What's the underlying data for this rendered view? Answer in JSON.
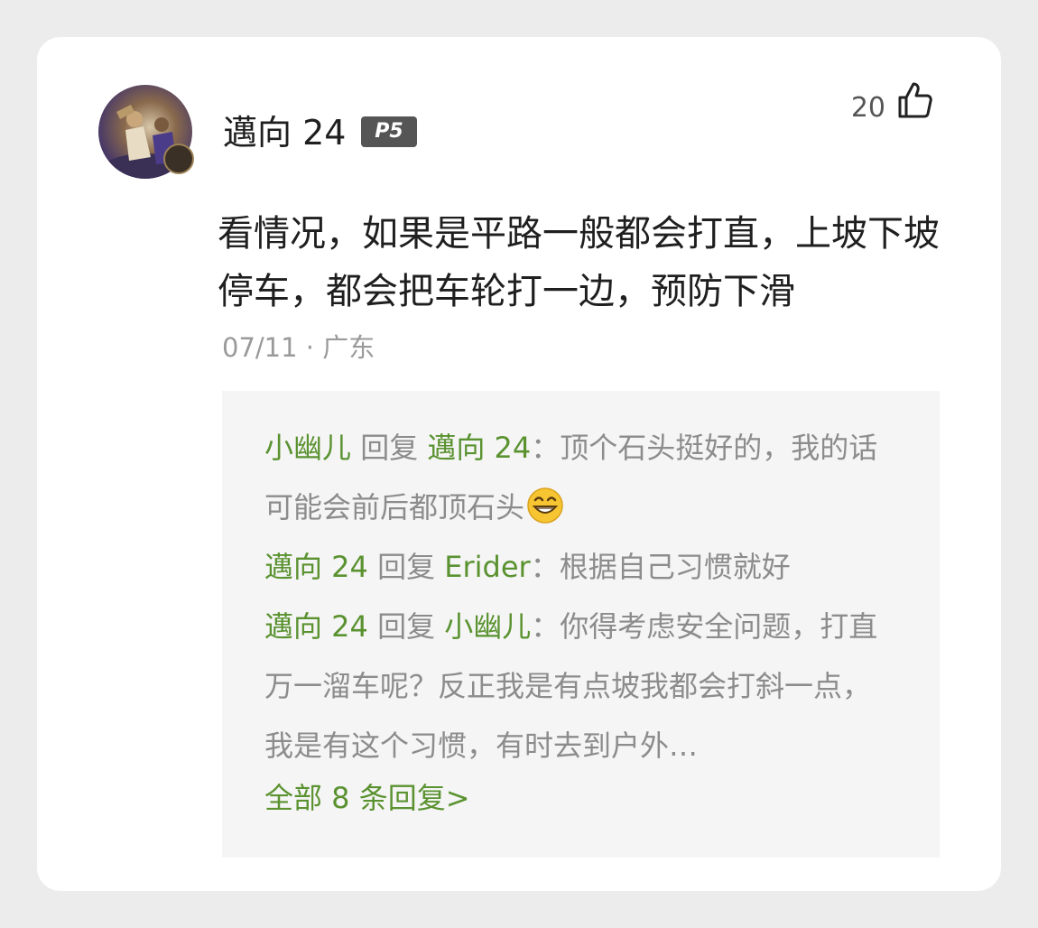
{
  "post": {
    "username": "邁向 24",
    "level_badge": "P5",
    "likes": "20",
    "comment_text": "看情况，如果是平路一般都会打直，上坡下坡停车，都会把车轮打一边，预防下滑",
    "date": "07/11",
    "meta_separator": " · ",
    "location": "广东"
  },
  "replies": [
    {
      "author": "小幽儿",
      "verb": "回复",
      "target": "邁向 24",
      "colon": "：",
      "text": "顶个石头挺好的，我的话可能会前后都顶石头",
      "emoji": "grinning-face-emoji"
    },
    {
      "author": "邁向 24",
      "verb": "回复",
      "target": "Erider",
      "colon": "：",
      "text": "根据自己习惯就好"
    },
    {
      "author": "邁向 24",
      "verb": "回复",
      "target": "小幽儿",
      "colon": "：",
      "text": "你得考虑安全问题，打直万一溜车呢？反正我是有点坡我都会打斜一点，我是有这个习惯，有时去到户外…"
    }
  ],
  "all_replies_label": "全部 8 条回复>",
  "colors": {
    "background": "#ececec",
    "card": "#ffffff",
    "reply_panel": "#f5f5f5",
    "accent_green": "#5a9230",
    "text_primary": "#1f1f1f",
    "text_secondary": "#8c8c8c"
  }
}
